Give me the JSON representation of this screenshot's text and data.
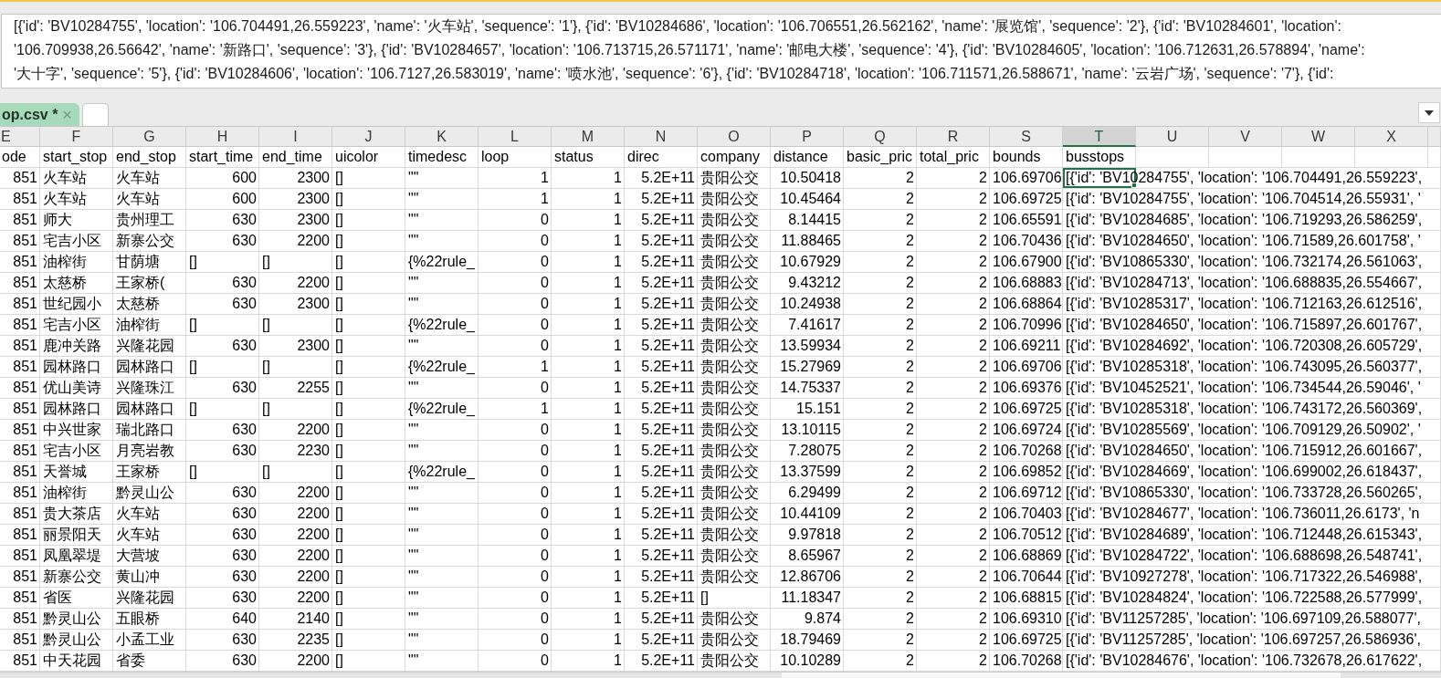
{
  "formula_bar": {
    "lines": [
      "[{'id': 'BV10284755', 'location': '106.704491,26.559223', 'name': '火车站', 'sequence': '1'}, {'id': 'BV10284686', 'location': '106.706551,26.562162', 'name': '展览馆', 'sequence': '2'}, {'id': 'BV10284601', 'location':",
      "'106.709938,26.56642', 'name': '新路口', 'sequence': '3'}, {'id': 'BV10284657', 'location': '106.713715,26.571171', 'name': '邮电大楼', 'sequence': '4'}, {'id': 'BV10284605', 'location': '106.712631,26.578894', 'name':",
      "'大十字', 'sequence': '5'}, {'id': 'BV10284606', 'location': '106.7127,26.583019', 'name': '喷水池', 'sequence': '6'}, {'id': 'BV10284718', 'location': '106.711571,26.588671', 'name': '云岩广场', 'sequence': '7'}, {'id':"
    ]
  },
  "tabs": [
    {
      "label": "op.csv *",
      "close": "×",
      "selected": true
    }
  ],
  "table": {
    "columns": [
      {
        "letter": "E",
        "selected": false
      },
      {
        "letter": "F",
        "selected": false
      },
      {
        "letter": "G",
        "selected": false
      },
      {
        "letter": "H",
        "selected": false
      },
      {
        "letter": "I",
        "selected": false
      },
      {
        "letter": "J",
        "selected": false
      },
      {
        "letter": "K",
        "selected": false
      },
      {
        "letter": "L",
        "selected": false
      },
      {
        "letter": "M",
        "selected": false
      },
      {
        "letter": "N",
        "selected": false
      },
      {
        "letter": "O",
        "selected": false
      },
      {
        "letter": "P",
        "selected": false
      },
      {
        "letter": "Q",
        "selected": false
      },
      {
        "letter": "R",
        "selected": false
      },
      {
        "letter": "S",
        "selected": false
      },
      {
        "letter": "T",
        "selected": true
      },
      {
        "letter": "U",
        "selected": false
      },
      {
        "letter": "V",
        "selected": false
      },
      {
        "letter": "W",
        "selected": false
      },
      {
        "letter": "X",
        "selected": false
      }
    ],
    "rows": [
      {
        "selected": false,
        "cells": [
          {
            "text": "ode",
            "kind": "text"
          },
          {
            "text": "start_stop",
            "kind": "text"
          },
          {
            "text": "end_stop",
            "kind": "text"
          },
          {
            "text": "start_time",
            "kind": "text"
          },
          {
            "text": "end_time",
            "kind": "text"
          },
          {
            "text": "uicolor",
            "kind": "text"
          },
          {
            "text": "timedesc",
            "kind": "text"
          },
          {
            "text": "loop",
            "kind": "text"
          },
          {
            "text": "status",
            "kind": "text"
          },
          {
            "text": "direc",
            "kind": "text"
          },
          {
            "text": "company",
            "kind": "text"
          },
          {
            "text": "distance",
            "kind": "text"
          },
          {
            "text": "basic_pric",
            "kind": "text"
          },
          {
            "text": "total_pric",
            "kind": "text"
          },
          {
            "text": "bounds",
            "kind": "text"
          },
          {
            "text": "busstops",
            "kind": "text"
          }
        ]
      },
      {
        "selected": true,
        "cells": [
          {
            "text": "851",
            "kind": "number"
          },
          {
            "text": "火车站",
            "kind": "text"
          },
          {
            "text": "火车站",
            "kind": "text"
          },
          {
            "text": "600",
            "kind": "number"
          },
          {
            "text": "2300",
            "kind": "number"
          },
          {
            "text": "[]",
            "kind": "text"
          },
          {
            "text": "\"\"",
            "kind": "text"
          },
          {
            "text": "1",
            "kind": "number"
          },
          {
            "text": "1",
            "kind": "number"
          },
          {
            "text": "5.2E+11",
            "kind": "number"
          },
          {
            "text": "贵阳公交",
            "kind": "text"
          },
          {
            "text": "10.50418",
            "kind": "number"
          },
          {
            "text": "2",
            "kind": "number"
          },
          {
            "text": "2",
            "kind": "number"
          },
          {
            "text": "106.69706",
            "kind": "number"
          },
          {
            "text": "[{'id': 'BV10284755', 'location': '106.704491,26.559223',",
            "kind": "text"
          }
        ]
      },
      {
        "selected": false,
        "cells": [
          {
            "text": "851",
            "kind": "number"
          },
          {
            "text": "火车站",
            "kind": "text"
          },
          {
            "text": "火车站",
            "kind": "text"
          },
          {
            "text": "600",
            "kind": "number"
          },
          {
            "text": "2300",
            "kind": "number"
          },
          {
            "text": "[]",
            "kind": "text"
          },
          {
            "text": "\"\"",
            "kind": "text"
          },
          {
            "text": "1",
            "kind": "number"
          },
          {
            "text": "1",
            "kind": "number"
          },
          {
            "text": "5.2E+11",
            "kind": "number"
          },
          {
            "text": "贵阳公交",
            "kind": "text"
          },
          {
            "text": "10.45464",
            "kind": "number"
          },
          {
            "text": "2",
            "kind": "number"
          },
          {
            "text": "2",
            "kind": "number"
          },
          {
            "text": "106.69725",
            "kind": "number"
          },
          {
            "text": "[{'id': 'BV10284755', 'location': '106.704514,26.55931', '",
            "kind": "text"
          }
        ]
      },
      {
        "selected": false,
        "cells": [
          {
            "text": "851",
            "kind": "number"
          },
          {
            "text": "师大",
            "kind": "text"
          },
          {
            "text": "贵州理工",
            "kind": "text"
          },
          {
            "text": "630",
            "kind": "number"
          },
          {
            "text": "2300",
            "kind": "number"
          },
          {
            "text": "[]",
            "kind": "text"
          },
          {
            "text": "\"\"",
            "kind": "text"
          },
          {
            "text": "0",
            "kind": "number"
          },
          {
            "text": "1",
            "kind": "number"
          },
          {
            "text": "5.2E+11",
            "kind": "number"
          },
          {
            "text": "贵阳公交",
            "kind": "text"
          },
          {
            "text": "8.14415",
            "kind": "number"
          },
          {
            "text": "2",
            "kind": "number"
          },
          {
            "text": "2",
            "kind": "number"
          },
          {
            "text": "106.65591",
            "kind": "number"
          },
          {
            "text": "[{'id': 'BV10284685', 'location': '106.719293,26.586259',",
            "kind": "text"
          }
        ]
      },
      {
        "selected": false,
        "cells": [
          {
            "text": "851",
            "kind": "number"
          },
          {
            "text": "宅吉小区",
            "kind": "text"
          },
          {
            "text": "新寨公交",
            "kind": "text"
          },
          {
            "text": "630",
            "kind": "number"
          },
          {
            "text": "2200",
            "kind": "number"
          },
          {
            "text": "[]",
            "kind": "text"
          },
          {
            "text": "\"\"",
            "kind": "text"
          },
          {
            "text": "0",
            "kind": "number"
          },
          {
            "text": "1",
            "kind": "number"
          },
          {
            "text": "5.2E+11",
            "kind": "number"
          },
          {
            "text": "贵阳公交",
            "kind": "text"
          },
          {
            "text": "11.88465",
            "kind": "number"
          },
          {
            "text": "2",
            "kind": "number"
          },
          {
            "text": "2",
            "kind": "number"
          },
          {
            "text": "106.70436",
            "kind": "number"
          },
          {
            "text": "[{'id': 'BV10284650', 'location': '106.71589,26.601758', '",
            "kind": "text"
          }
        ]
      },
      {
        "selected": false,
        "cells": [
          {
            "text": "851",
            "kind": "number"
          },
          {
            "text": "油榨街",
            "kind": "text"
          },
          {
            "text": "甘荫塘",
            "kind": "text"
          },
          {
            "text": "[]",
            "kind": "text"
          },
          {
            "text": "[]",
            "kind": "text"
          },
          {
            "text": "[]",
            "kind": "text"
          },
          {
            "text": "{%22rule_",
            "kind": "text"
          },
          {
            "text": "0",
            "kind": "number"
          },
          {
            "text": "1",
            "kind": "number"
          },
          {
            "text": "5.2E+11",
            "kind": "number"
          },
          {
            "text": "贵阳公交",
            "kind": "text"
          },
          {
            "text": "10.67929",
            "kind": "number"
          },
          {
            "text": "2",
            "kind": "number"
          },
          {
            "text": "2",
            "kind": "number"
          },
          {
            "text": "106.67900",
            "kind": "number"
          },
          {
            "text": "[{'id': 'BV10865330', 'location': '106.732174,26.561063',",
            "kind": "text"
          }
        ]
      },
      {
        "selected": false,
        "cells": [
          {
            "text": "851",
            "kind": "number"
          },
          {
            "text": "太慈桥",
            "kind": "text"
          },
          {
            "text": "王家桥(",
            "kind": "text"
          },
          {
            "text": "630",
            "kind": "number"
          },
          {
            "text": "2200",
            "kind": "number"
          },
          {
            "text": "[]",
            "kind": "text"
          },
          {
            "text": "\"\"",
            "kind": "text"
          },
          {
            "text": "0",
            "kind": "number"
          },
          {
            "text": "1",
            "kind": "number"
          },
          {
            "text": "5.2E+11",
            "kind": "number"
          },
          {
            "text": "贵阳公交",
            "kind": "text"
          },
          {
            "text": "9.43212",
            "kind": "number"
          },
          {
            "text": "2",
            "kind": "number"
          },
          {
            "text": "2",
            "kind": "number"
          },
          {
            "text": "106.68883",
            "kind": "number"
          },
          {
            "text": "[{'id': 'BV10284713', 'location': '106.688835,26.554667',",
            "kind": "text"
          }
        ]
      },
      {
        "selected": false,
        "cells": [
          {
            "text": "851",
            "kind": "number"
          },
          {
            "text": "世纪园小",
            "kind": "text"
          },
          {
            "text": "太慈桥",
            "kind": "text"
          },
          {
            "text": "630",
            "kind": "number"
          },
          {
            "text": "2300",
            "kind": "number"
          },
          {
            "text": "[]",
            "kind": "text"
          },
          {
            "text": "\"\"",
            "kind": "text"
          },
          {
            "text": "0",
            "kind": "number"
          },
          {
            "text": "1",
            "kind": "number"
          },
          {
            "text": "5.2E+11",
            "kind": "number"
          },
          {
            "text": "贵阳公交",
            "kind": "text"
          },
          {
            "text": "10.24938",
            "kind": "number"
          },
          {
            "text": "2",
            "kind": "number"
          },
          {
            "text": "2",
            "kind": "number"
          },
          {
            "text": "106.68864",
            "kind": "number"
          },
          {
            "text": "[{'id': 'BV10285317', 'location': '106.712163,26.612516',",
            "kind": "text"
          }
        ]
      },
      {
        "selected": false,
        "cells": [
          {
            "text": "851",
            "kind": "number"
          },
          {
            "text": "宅吉小区",
            "kind": "text"
          },
          {
            "text": "油榨街",
            "kind": "text"
          },
          {
            "text": "[]",
            "kind": "text"
          },
          {
            "text": "[]",
            "kind": "text"
          },
          {
            "text": "[]",
            "kind": "text"
          },
          {
            "text": "{%22rule_",
            "kind": "text"
          },
          {
            "text": "0",
            "kind": "number"
          },
          {
            "text": "1",
            "kind": "number"
          },
          {
            "text": "5.2E+11",
            "kind": "number"
          },
          {
            "text": "贵阳公交",
            "kind": "text"
          },
          {
            "text": "7.41617",
            "kind": "number"
          },
          {
            "text": "2",
            "kind": "number"
          },
          {
            "text": "2",
            "kind": "number"
          },
          {
            "text": "106.70996",
            "kind": "number"
          },
          {
            "text": "[{'id': 'BV10284650', 'location': '106.715897,26.601767',",
            "kind": "text"
          }
        ]
      },
      {
        "selected": false,
        "cells": [
          {
            "text": "851",
            "kind": "number"
          },
          {
            "text": "鹿冲关路",
            "kind": "text"
          },
          {
            "text": "兴隆花园",
            "kind": "text"
          },
          {
            "text": "630",
            "kind": "number"
          },
          {
            "text": "2300",
            "kind": "number"
          },
          {
            "text": "[]",
            "kind": "text"
          },
          {
            "text": "\"\"",
            "kind": "text"
          },
          {
            "text": "0",
            "kind": "number"
          },
          {
            "text": "1",
            "kind": "number"
          },
          {
            "text": "5.2E+11",
            "kind": "number"
          },
          {
            "text": "贵阳公交",
            "kind": "text"
          },
          {
            "text": "13.59934",
            "kind": "number"
          },
          {
            "text": "2",
            "kind": "number"
          },
          {
            "text": "2",
            "kind": "number"
          },
          {
            "text": "106.69211",
            "kind": "number"
          },
          {
            "text": "[{'id': 'BV10284692', 'location': '106.720308,26.605729',",
            "kind": "text"
          }
        ]
      },
      {
        "selected": false,
        "cells": [
          {
            "text": "851",
            "kind": "number"
          },
          {
            "text": "园林路口",
            "kind": "text"
          },
          {
            "text": "园林路口",
            "kind": "text"
          },
          {
            "text": "[]",
            "kind": "text"
          },
          {
            "text": "[]",
            "kind": "text"
          },
          {
            "text": "[]",
            "kind": "text"
          },
          {
            "text": "{%22rule_",
            "kind": "text"
          },
          {
            "text": "1",
            "kind": "number"
          },
          {
            "text": "1",
            "kind": "number"
          },
          {
            "text": "5.2E+11",
            "kind": "number"
          },
          {
            "text": "贵阳公交",
            "kind": "text"
          },
          {
            "text": "15.27969",
            "kind": "number"
          },
          {
            "text": "2",
            "kind": "number"
          },
          {
            "text": "2",
            "kind": "number"
          },
          {
            "text": "106.69706",
            "kind": "number"
          },
          {
            "text": "[{'id': 'BV10285318', 'location': '106.743095,26.560377',",
            "kind": "text"
          }
        ]
      },
      {
        "selected": false,
        "cells": [
          {
            "text": "851",
            "kind": "number"
          },
          {
            "text": "优山美诗",
            "kind": "text"
          },
          {
            "text": "兴隆珠江",
            "kind": "text"
          },
          {
            "text": "630",
            "kind": "number"
          },
          {
            "text": "2255",
            "kind": "number"
          },
          {
            "text": "[]",
            "kind": "text"
          },
          {
            "text": "\"\"",
            "kind": "text"
          },
          {
            "text": "0",
            "kind": "number"
          },
          {
            "text": "1",
            "kind": "number"
          },
          {
            "text": "5.2E+11",
            "kind": "number"
          },
          {
            "text": "贵阳公交",
            "kind": "text"
          },
          {
            "text": "14.75337",
            "kind": "number"
          },
          {
            "text": "2",
            "kind": "number"
          },
          {
            "text": "2",
            "kind": "number"
          },
          {
            "text": "106.69376",
            "kind": "number"
          },
          {
            "text": "[{'id': 'BV10452521', 'location': '106.734544,26.59046', '",
            "kind": "text"
          }
        ]
      },
      {
        "selected": false,
        "cells": [
          {
            "text": "851",
            "kind": "number"
          },
          {
            "text": "园林路口",
            "kind": "text"
          },
          {
            "text": "园林路口",
            "kind": "text"
          },
          {
            "text": "[]",
            "kind": "text"
          },
          {
            "text": "[]",
            "kind": "text"
          },
          {
            "text": "[]",
            "kind": "text"
          },
          {
            "text": "{%22rule_",
            "kind": "text"
          },
          {
            "text": "1",
            "kind": "number"
          },
          {
            "text": "1",
            "kind": "number"
          },
          {
            "text": "5.2E+11",
            "kind": "number"
          },
          {
            "text": "贵阳公交",
            "kind": "text"
          },
          {
            "text": "15.151",
            "kind": "number"
          },
          {
            "text": "2",
            "kind": "number"
          },
          {
            "text": "2",
            "kind": "number"
          },
          {
            "text": "106.69725",
            "kind": "number"
          },
          {
            "text": "[{'id': 'BV10285318', 'location': '106.743172,26.560369',",
            "kind": "text"
          }
        ]
      },
      {
        "selected": false,
        "cells": [
          {
            "text": "851",
            "kind": "number"
          },
          {
            "text": "中兴世家",
            "kind": "text"
          },
          {
            "text": "瑞北路口",
            "kind": "text"
          },
          {
            "text": "630",
            "kind": "number"
          },
          {
            "text": "2200",
            "kind": "number"
          },
          {
            "text": "[]",
            "kind": "text"
          },
          {
            "text": "\"\"",
            "kind": "text"
          },
          {
            "text": "0",
            "kind": "number"
          },
          {
            "text": "1",
            "kind": "number"
          },
          {
            "text": "5.2E+11",
            "kind": "number"
          },
          {
            "text": "贵阳公交",
            "kind": "text"
          },
          {
            "text": "13.10115",
            "kind": "number"
          },
          {
            "text": "2",
            "kind": "number"
          },
          {
            "text": "2",
            "kind": "number"
          },
          {
            "text": "106.69724",
            "kind": "number"
          },
          {
            "text": "[{'id': 'BV10285569', 'location': '106.709129,26.50902', '",
            "kind": "text"
          }
        ]
      },
      {
        "selected": false,
        "cells": [
          {
            "text": "851",
            "kind": "number"
          },
          {
            "text": "宅吉小区",
            "kind": "text"
          },
          {
            "text": "月亮岩教",
            "kind": "text"
          },
          {
            "text": "630",
            "kind": "number"
          },
          {
            "text": "2230",
            "kind": "number"
          },
          {
            "text": "[]",
            "kind": "text"
          },
          {
            "text": "\"\"",
            "kind": "text"
          },
          {
            "text": "0",
            "kind": "number"
          },
          {
            "text": "1",
            "kind": "number"
          },
          {
            "text": "5.2E+11",
            "kind": "number"
          },
          {
            "text": "贵阳公交",
            "kind": "text"
          },
          {
            "text": "7.28075",
            "kind": "number"
          },
          {
            "text": "2",
            "kind": "number"
          },
          {
            "text": "2",
            "kind": "number"
          },
          {
            "text": "106.70268",
            "kind": "number"
          },
          {
            "text": "[{'id': 'BV10284650', 'location': '106.715912,26.601667',",
            "kind": "text"
          }
        ]
      },
      {
        "selected": false,
        "cells": [
          {
            "text": "851",
            "kind": "number"
          },
          {
            "text": "天誉城",
            "kind": "text"
          },
          {
            "text": "王家桥",
            "kind": "text"
          },
          {
            "text": "[]",
            "kind": "text"
          },
          {
            "text": "[]",
            "kind": "text"
          },
          {
            "text": "[]",
            "kind": "text"
          },
          {
            "text": "{%22rule_",
            "kind": "text"
          },
          {
            "text": "0",
            "kind": "number"
          },
          {
            "text": "1",
            "kind": "number"
          },
          {
            "text": "5.2E+11",
            "kind": "number"
          },
          {
            "text": "贵阳公交",
            "kind": "text"
          },
          {
            "text": "13.37599",
            "kind": "number"
          },
          {
            "text": "2",
            "kind": "number"
          },
          {
            "text": "2",
            "kind": "number"
          },
          {
            "text": "106.69852",
            "kind": "number"
          },
          {
            "text": "[{'id': 'BV10284669', 'location': '106.699002,26.618437',",
            "kind": "text"
          }
        ]
      },
      {
        "selected": false,
        "cells": [
          {
            "text": "851",
            "kind": "number"
          },
          {
            "text": "油榨街",
            "kind": "text"
          },
          {
            "text": "黔灵山公",
            "kind": "text"
          },
          {
            "text": "630",
            "kind": "number"
          },
          {
            "text": "2200",
            "kind": "number"
          },
          {
            "text": "[]",
            "kind": "text"
          },
          {
            "text": "\"\"",
            "kind": "text"
          },
          {
            "text": "0",
            "kind": "number"
          },
          {
            "text": "1",
            "kind": "number"
          },
          {
            "text": "5.2E+11",
            "kind": "number"
          },
          {
            "text": "贵阳公交",
            "kind": "text"
          },
          {
            "text": "6.29499",
            "kind": "number"
          },
          {
            "text": "2",
            "kind": "number"
          },
          {
            "text": "2",
            "kind": "number"
          },
          {
            "text": "106.69712",
            "kind": "number"
          },
          {
            "text": "[{'id': 'BV10865330', 'location': '106.733728,26.560265',",
            "kind": "text"
          }
        ]
      },
      {
        "selected": false,
        "cells": [
          {
            "text": "851",
            "kind": "number"
          },
          {
            "text": "贵大茶店",
            "kind": "text"
          },
          {
            "text": "火车站",
            "kind": "text"
          },
          {
            "text": "630",
            "kind": "number"
          },
          {
            "text": "2200",
            "kind": "number"
          },
          {
            "text": "[]",
            "kind": "text"
          },
          {
            "text": "\"\"",
            "kind": "text"
          },
          {
            "text": "0",
            "kind": "number"
          },
          {
            "text": "1",
            "kind": "number"
          },
          {
            "text": "5.2E+11",
            "kind": "number"
          },
          {
            "text": "贵阳公交",
            "kind": "text"
          },
          {
            "text": "10.44109",
            "kind": "number"
          },
          {
            "text": "2",
            "kind": "number"
          },
          {
            "text": "2",
            "kind": "number"
          },
          {
            "text": "106.70403",
            "kind": "number"
          },
          {
            "text": "[{'id': 'BV10284677', 'location': '106.736011,26.6173', 'n",
            "kind": "text"
          }
        ]
      },
      {
        "selected": false,
        "cells": [
          {
            "text": "851",
            "kind": "number"
          },
          {
            "text": "丽景阳天",
            "kind": "text"
          },
          {
            "text": "火车站",
            "kind": "text"
          },
          {
            "text": "630",
            "kind": "number"
          },
          {
            "text": "2200",
            "kind": "number"
          },
          {
            "text": "[]",
            "kind": "text"
          },
          {
            "text": "\"\"",
            "kind": "text"
          },
          {
            "text": "0",
            "kind": "number"
          },
          {
            "text": "1",
            "kind": "number"
          },
          {
            "text": "5.2E+11",
            "kind": "number"
          },
          {
            "text": "贵阳公交",
            "kind": "text"
          },
          {
            "text": "9.97818",
            "kind": "number"
          },
          {
            "text": "2",
            "kind": "number"
          },
          {
            "text": "2",
            "kind": "number"
          },
          {
            "text": "106.70512",
            "kind": "number"
          },
          {
            "text": "[{'id': 'BV10284689', 'location': '106.712448,26.615343',",
            "kind": "text"
          }
        ]
      },
      {
        "selected": false,
        "cells": [
          {
            "text": "851",
            "kind": "number"
          },
          {
            "text": "凤凰翠堤",
            "kind": "text"
          },
          {
            "text": "大营坡",
            "kind": "text"
          },
          {
            "text": "630",
            "kind": "number"
          },
          {
            "text": "2200",
            "kind": "number"
          },
          {
            "text": "[]",
            "kind": "text"
          },
          {
            "text": "\"\"",
            "kind": "text"
          },
          {
            "text": "0",
            "kind": "number"
          },
          {
            "text": "1",
            "kind": "number"
          },
          {
            "text": "5.2E+11",
            "kind": "number"
          },
          {
            "text": "贵阳公交",
            "kind": "text"
          },
          {
            "text": "8.65967",
            "kind": "number"
          },
          {
            "text": "2",
            "kind": "number"
          },
          {
            "text": "2",
            "kind": "number"
          },
          {
            "text": "106.68869",
            "kind": "number"
          },
          {
            "text": "[{'id': 'BV10284722', 'location': '106.688698,26.548741',",
            "kind": "text"
          }
        ]
      },
      {
        "selected": false,
        "cells": [
          {
            "text": "851",
            "kind": "number"
          },
          {
            "text": "新寨公交",
            "kind": "text"
          },
          {
            "text": "黄山冲",
            "kind": "text"
          },
          {
            "text": "630",
            "kind": "number"
          },
          {
            "text": "2200",
            "kind": "number"
          },
          {
            "text": "[]",
            "kind": "text"
          },
          {
            "text": "\"\"",
            "kind": "text"
          },
          {
            "text": "0",
            "kind": "number"
          },
          {
            "text": "1",
            "kind": "number"
          },
          {
            "text": "5.2E+11",
            "kind": "number"
          },
          {
            "text": "贵阳公交",
            "kind": "text"
          },
          {
            "text": "12.86706",
            "kind": "number"
          },
          {
            "text": "2",
            "kind": "number"
          },
          {
            "text": "2",
            "kind": "number"
          },
          {
            "text": "106.70644",
            "kind": "number"
          },
          {
            "text": "[{'id': 'BV10927278', 'location': '106.717322,26.546988',",
            "kind": "text"
          }
        ]
      },
      {
        "selected": false,
        "cells": [
          {
            "text": "851",
            "kind": "number"
          },
          {
            "text": "省医",
            "kind": "text"
          },
          {
            "text": "兴隆花园",
            "kind": "text"
          },
          {
            "text": "630",
            "kind": "number"
          },
          {
            "text": "2200",
            "kind": "number"
          },
          {
            "text": "[]",
            "kind": "text"
          },
          {
            "text": "\"\"",
            "kind": "text"
          },
          {
            "text": "0",
            "kind": "number"
          },
          {
            "text": "1",
            "kind": "number"
          },
          {
            "text": "5.2E+11",
            "kind": "number"
          },
          {
            "text": "[]",
            "kind": "text"
          },
          {
            "text": "11.18347",
            "kind": "number"
          },
          {
            "text": "2",
            "kind": "number"
          },
          {
            "text": "2",
            "kind": "number"
          },
          {
            "text": "106.68815",
            "kind": "number"
          },
          {
            "text": "[{'id': 'BV10284824', 'location': '106.722588,26.577999',",
            "kind": "text"
          }
        ]
      },
      {
        "selected": false,
        "cells": [
          {
            "text": "851",
            "kind": "number"
          },
          {
            "text": "黔灵山公",
            "kind": "text"
          },
          {
            "text": "五眼桥",
            "kind": "text"
          },
          {
            "text": "640",
            "kind": "number"
          },
          {
            "text": "2140",
            "kind": "number"
          },
          {
            "text": "[]",
            "kind": "text"
          },
          {
            "text": "\"\"",
            "kind": "text"
          },
          {
            "text": "0",
            "kind": "number"
          },
          {
            "text": "1",
            "kind": "number"
          },
          {
            "text": "5.2E+11",
            "kind": "number"
          },
          {
            "text": "贵阳公交",
            "kind": "text"
          },
          {
            "text": "9.874",
            "kind": "number"
          },
          {
            "text": "2",
            "kind": "number"
          },
          {
            "text": "2",
            "kind": "number"
          },
          {
            "text": "106.69310",
            "kind": "number"
          },
          {
            "text": "[{'id': 'BV11257285', 'location': '106.697109,26.588077',",
            "kind": "text"
          }
        ]
      },
      {
        "selected": false,
        "cells": [
          {
            "text": "851",
            "kind": "number"
          },
          {
            "text": "黔灵山公",
            "kind": "text"
          },
          {
            "text": "小孟工业",
            "kind": "text"
          },
          {
            "text": "630",
            "kind": "number"
          },
          {
            "text": "2235",
            "kind": "number"
          },
          {
            "text": "[]",
            "kind": "text"
          },
          {
            "text": "\"\"",
            "kind": "text"
          },
          {
            "text": "0",
            "kind": "number"
          },
          {
            "text": "1",
            "kind": "number"
          },
          {
            "text": "5.2E+11",
            "kind": "number"
          },
          {
            "text": "贵阳公交",
            "kind": "text"
          },
          {
            "text": "18.79469",
            "kind": "number"
          },
          {
            "text": "2",
            "kind": "number"
          },
          {
            "text": "2",
            "kind": "number"
          },
          {
            "text": "106.69725",
            "kind": "number"
          },
          {
            "text": "[{'id': 'BV11257285', 'location': '106.697257,26.586936',",
            "kind": "text"
          }
        ]
      },
      {
        "selected": false,
        "cells": [
          {
            "text": "851",
            "kind": "number"
          },
          {
            "text": "中天花园",
            "kind": "text"
          },
          {
            "text": "省委",
            "kind": "text"
          },
          {
            "text": "630",
            "kind": "number"
          },
          {
            "text": "2200",
            "kind": "number"
          },
          {
            "text": "[]",
            "kind": "text"
          },
          {
            "text": "\"\"",
            "kind": "text"
          },
          {
            "text": "0",
            "kind": "number"
          },
          {
            "text": "1",
            "kind": "number"
          },
          {
            "text": "5.2E+11",
            "kind": "number"
          },
          {
            "text": "贵阳公交",
            "kind": "text"
          },
          {
            "text": "10.10289",
            "kind": "number"
          },
          {
            "text": "2",
            "kind": "number"
          },
          {
            "text": "2",
            "kind": "number"
          },
          {
            "text": "106.70268",
            "kind": "number"
          },
          {
            "text": "[{'id': 'BV10284676', 'location': '106.732678,26.617622',",
            "kind": "text"
          }
        ]
      }
    ]
  }
}
